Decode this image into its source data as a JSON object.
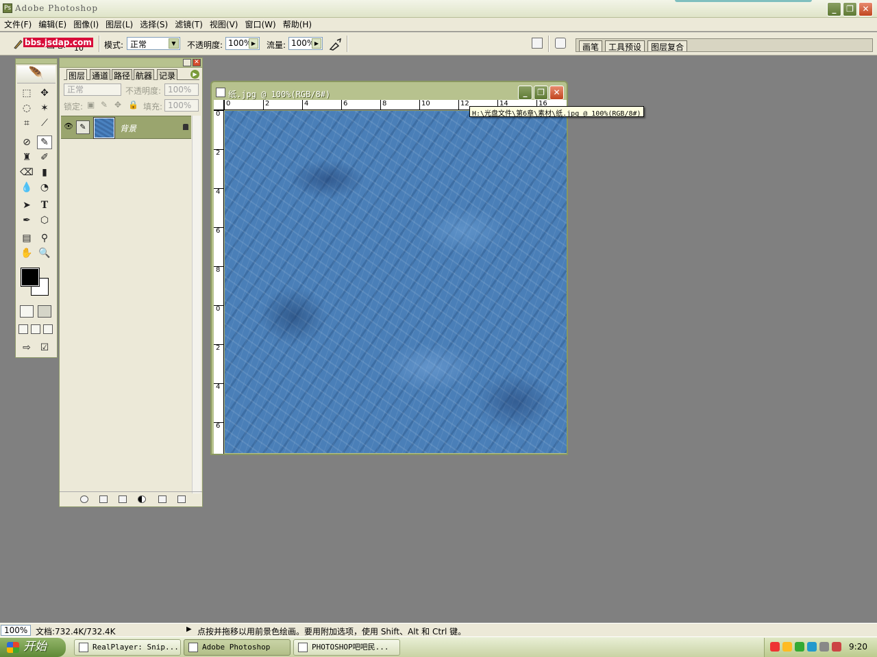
{
  "app": {
    "title": "Adobe Photoshop"
  },
  "window_controls": {
    "minimize": "_",
    "maximize": "❐",
    "close": "✕"
  },
  "menu": [
    "文件(F)",
    "编辑(E)",
    "图像(I)",
    "图层(L)",
    "选择(S)",
    "滤镜(T)",
    "视图(V)",
    "窗口(W)",
    "帮助(H)"
  ],
  "watermark": "bbs.jsdap.com",
  "options_bar": {
    "brush_label": "画笔:",
    "brush_size": "10",
    "mode_label": "模式:",
    "mode_value": "正常",
    "opacity_label": "不透明度:",
    "opacity_value": "100%",
    "flow_label": "流量:",
    "flow_value": "100%",
    "palette_well_tabs": [
      "画笔",
      "工具预设",
      "图层复合"
    ]
  },
  "layers_palette": {
    "tabs": [
      "图层",
      "通道",
      "路径",
      "航器",
      "记录"
    ],
    "blend_mode": "正常",
    "opacity_label": "不透明度:",
    "opacity_value": "100%",
    "lock_label": "锁定:",
    "fill_label": "填充:",
    "fill_value": "100%",
    "layers": [
      {
        "name": "背景",
        "visible": true,
        "locked": true
      }
    ]
  },
  "document": {
    "title": "纸.jpg @ 100%(RGB/8#)",
    "tooltip": "H:\\光盘文件\\第6章\\素材\\纸.jpg @ 100%(RGB/8#)",
    "ruler_h": [
      "0",
      "2",
      "4",
      "6",
      "8",
      "10",
      "12",
      "14",
      "16"
    ],
    "ruler_v": [
      "0",
      "2",
      "4",
      "6",
      "8",
      "0",
      "2",
      "4",
      "6"
    ],
    "canvas_color": "#4a7fb8"
  },
  "status_bar": {
    "zoom": "100%",
    "doc_size": "文档:732.4K/732.4K",
    "hint": "点按并拖移以用前景色绘画。要用附加选项，使用 Shift、Alt 和 Ctrl 键。"
  },
  "taskbar": {
    "start_label": "开始",
    "tasks": [
      {
        "label": "RealPlayer: Snip...",
        "active": false
      },
      {
        "label": "Adobe Photoshop",
        "active": true
      },
      {
        "label": "PHOTOSHOP吧吧民...",
        "active": false
      }
    ],
    "clock": "9:20"
  },
  "colors": {
    "foreground": "#000000",
    "background": "#ffffff",
    "layer_selected": "#9aa56e"
  }
}
